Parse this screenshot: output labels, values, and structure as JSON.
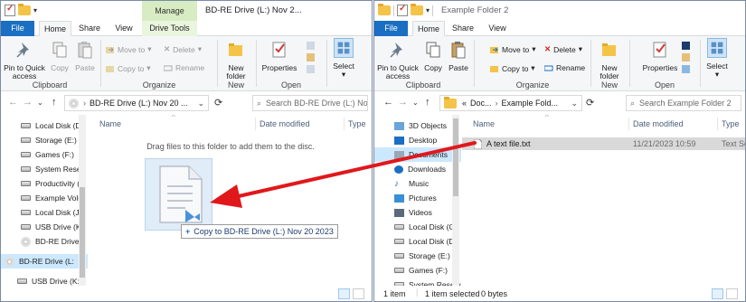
{
  "left_window": {
    "title": "BD-RE Drive (L:) Nov 2...",
    "contextual_tab": "Manage",
    "tabs": [
      "File",
      "Home",
      "Share",
      "View",
      "Drive Tools"
    ],
    "ribbon": {
      "pin_label": "Pin to Quick access",
      "copy_label": "Copy",
      "paste_label": "Paste",
      "clipboard_group": "Clipboard",
      "move_to": "Move to",
      "copy_to": "Copy to",
      "delete": "Delete",
      "rename": "Rename",
      "organize_group": "Organize",
      "new_folder": "New folder",
      "new_group": "New",
      "properties": "Properties",
      "open_group": "Open",
      "select": "Select"
    },
    "address": "BD-RE Drive (L:) Nov 20 ...",
    "search_placeholder": "Search BD-RE Drive (L:) Nov ...",
    "nav_items": [
      "Local Disk (D:",
      "Storage (E:)",
      "Games (F:)",
      "System Reser",
      "Productivity (",
      "Example Volu",
      "Local Disk (J:)",
      "USB Drive (K:",
      "BD-RE Drive (",
      "BD-RE Drive (L:",
      "USB Drive (K:)"
    ],
    "columns": [
      "Name",
      "Date modified",
      "Type"
    ],
    "empty_message": "Drag files to this folder to add them to the disc.",
    "drag_tooltip": "Copy to BD-RE Drive (L:) Nov 20 2023",
    "drag_plus": "+"
  },
  "right_window": {
    "title": "Example Folder 2",
    "tabs": [
      "File",
      "Home",
      "Share",
      "View"
    ],
    "ribbon": {
      "pin_label": "Pin to Quick access",
      "copy_label": "Copy",
      "paste_label": "Paste",
      "clipboard_group": "Clipboard",
      "move_to": "Move to",
      "copy_to": "Copy to",
      "delete": "Delete",
      "rename": "Rename",
      "organize_group": "Organize",
      "new_folder": "New folder",
      "new_group": "New",
      "properties": "Properties",
      "open_group": "Open",
      "select": "Select"
    },
    "address_prefix": "«",
    "address_parts": [
      "Doc...",
      "Example Fold..."
    ],
    "search_placeholder": "Search Example Folder 2",
    "nav_items": [
      "3D Objects",
      "Desktop",
      "Documents",
      "Downloads",
      "Music",
      "Pictures",
      "Videos",
      "Local Disk (C:",
      "Local Disk (D:",
      "Storage (E:)",
      "Games (F:)",
      "System Reserv"
    ],
    "columns": [
      "Name",
      "Date modified",
      "Type"
    ],
    "files": [
      {
        "name": "A text file.txt",
        "date": "11/21/2023 10:59",
        "type": "Text Sc"
      }
    ],
    "status": {
      "count": "1 item",
      "selected": "1 item selected",
      "size": "0 bytes"
    }
  },
  "colors": {
    "file_tab": "#1a6fc2",
    "manage_tab": "#d8ecc3",
    "arrow": "#e0181c",
    "selection": "#cce8ff"
  }
}
